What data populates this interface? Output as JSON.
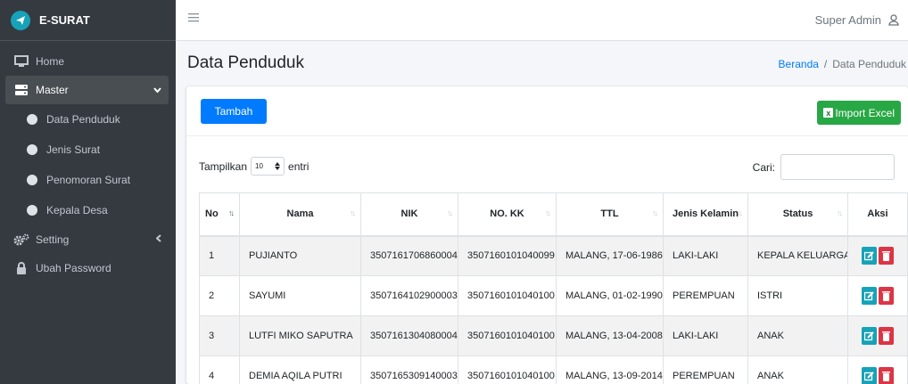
{
  "brand": {
    "name": "E-SURAT"
  },
  "sidebar": {
    "items": [
      {
        "label": "Home"
      },
      {
        "label": "Master"
      },
      {
        "label": "Data Penduduk"
      },
      {
        "label": "Jenis Surat"
      },
      {
        "label": "Penomoran Surat"
      },
      {
        "label": "Kepala Desa"
      },
      {
        "label": "Setting"
      },
      {
        "label": "Ubah Password"
      }
    ]
  },
  "topbar": {
    "user": "Super Admin"
  },
  "page": {
    "title": "Data Penduduk",
    "breadcrumb": {
      "home": "Beranda",
      "sep": "/",
      "current": "Data Penduduk"
    }
  },
  "card": {
    "add_button": "Tambah",
    "import_button": "Import Excel",
    "show_prefix": "Tampilkan",
    "show_value": "10",
    "show_suffix": "entri",
    "search_label": "Cari:"
  },
  "table": {
    "headers": [
      "No",
      "Nama",
      "NIK",
      "NO. KK",
      "TTL",
      "Jenis Kelamin",
      "Status",
      "Aksi"
    ],
    "rows": [
      [
        "1",
        "PUJIANTO",
        "3507161706860004",
        "3507160101040099",
        "MALANG, 17-06-1986",
        "LAKI-LAKI",
        "KEPALA KELUARGA"
      ],
      [
        "2",
        "SAYUMI",
        "3507164102900003",
        "3507160101040100",
        "MALANG, 01-02-1990",
        "PEREMPUAN",
        "ISTRI"
      ],
      [
        "3",
        "LUTFI MIKO SAPUTRA",
        "3507161304080004",
        "3507160101040100",
        "MALANG, 13-04-2008",
        "LAKI-LAKI",
        "ANAK"
      ],
      [
        "4",
        "DEMIA AQILA PUTRI",
        "3507165309140003",
        "3507160101040100",
        "MALANG, 13-09-2014",
        "PEREMPUAN",
        "ANAK"
      ]
    ]
  },
  "colors": {
    "sidebar_bg": "#343a40",
    "primary": "#007bff",
    "success": "#28a745",
    "info": "#17a2b8",
    "danger": "#dc3545"
  }
}
